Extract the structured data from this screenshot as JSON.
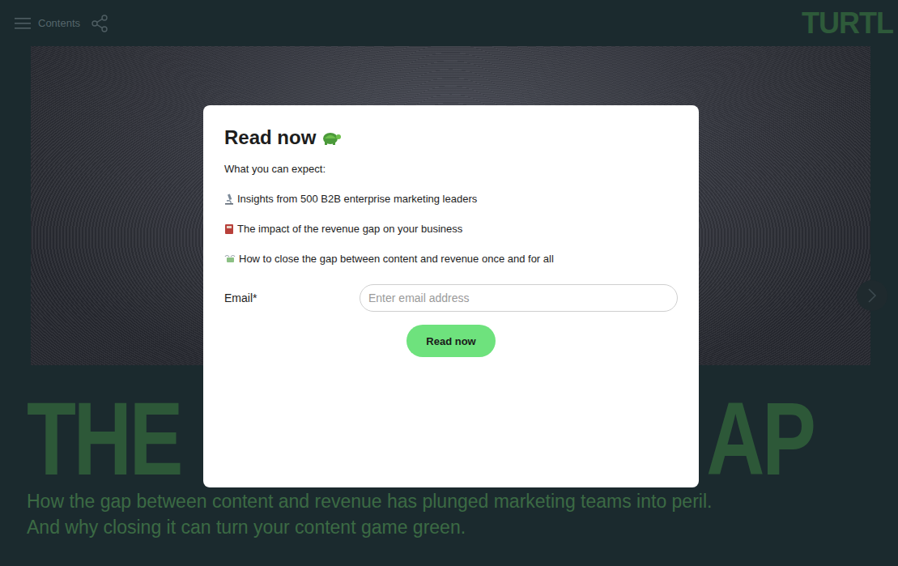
{
  "topbar": {
    "menu_label": "Contents",
    "logo": "TURTL"
  },
  "hero": {
    "headline_left": "THE",
    "headline_right": "AP",
    "subtitle": [
      "How the gap between content and revenue has plunged marketing teams into peril.",
      "And why closing it can turn your content game green."
    ]
  },
  "modal": {
    "title": "Read now",
    "intro": "What you can expect:",
    "items": [
      {
        "text": "Insights from 500 B2B enterprise marketing leaders"
      },
      {
        "text": "The impact of the revenue gap on your business"
      },
      {
        "text": "How to close the gap between content and revenue once and for all"
      }
    ],
    "email_label": "Email*",
    "email_placeholder": "Enter email address",
    "button": "Read now"
  }
}
